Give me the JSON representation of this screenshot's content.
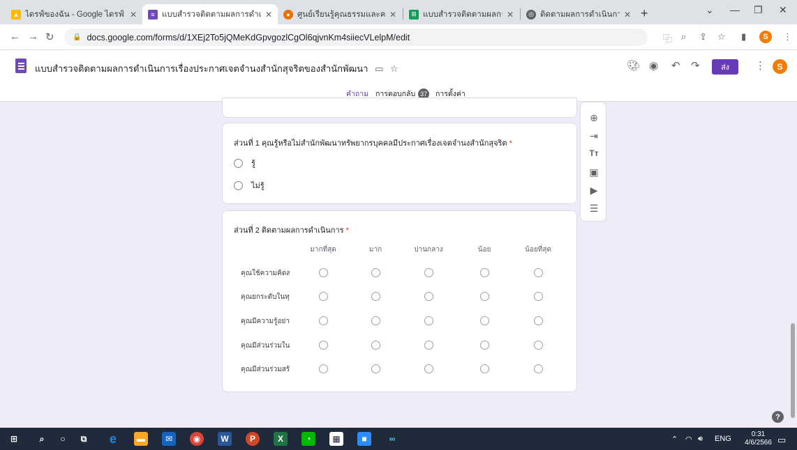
{
  "browser": {
    "tabs": [
      {
        "title": "ไดรฟ์ของฉัน - Google ไดรฟ์",
        "icon": "google-drive-icon",
        "color": "#1fa463"
      },
      {
        "title": "แบบสำรวจติดตามผลการดำเนินการ",
        "icon": "google-forms-icon",
        "color": "#7248b9"
      },
      {
        "title": "ศูนย์เรียนรู้คุณธรรมและความโปร่งใส",
        "icon": "site-icon",
        "color": "#e8710a"
      },
      {
        "title": "แบบสำรวจติดตามผลการดำเนินการ",
        "icon": "google-sheets-icon",
        "color": "#0f9d58"
      },
      {
        "title": "ติดตามผลการดำเนินการและรายงาน",
        "icon": "globe-icon",
        "color": "#5f6368"
      }
    ],
    "url": "docs.google.com/forms/d/1XEj2To5jQMeKdGpvgozlCgOl6qjvnKm4siiecVLelpM/edit",
    "profile_initial": "S"
  },
  "form_header": {
    "title": "แบบสำรวจติดตามผลการดำเนินการเรื่องประกาศเจตจำนงสำนักสุจริตของสำนักพัฒนา",
    "send_label": "ส่ง",
    "avatar_initial": "S",
    "tabs": {
      "questions": "คำถาม",
      "responses": "การตอบกลับ",
      "responses_count": "37",
      "settings": "การตั้งค่า"
    }
  },
  "section1": {
    "question": "ส่วนที่ 1 คุณรู้หรือไม่สำนักพัฒนาทรัพยากรบุคคลมีประกาศเรื่องเจตจำนงสำนักสุจริต",
    "required_mark": "*",
    "options": [
      "รู้",
      "ไม่รู้"
    ]
  },
  "section2": {
    "question": "ส่วนที่ 2 ติดตามผลการดำเนินการ",
    "required_mark": "*",
    "columns": [
      "มากที่สุด",
      "มาก",
      "ปานกลาง",
      "น้อย",
      "น้อยที่สุด"
    ],
    "rows": [
      "คุณใช้ความคิดส...",
      "คุณยกระดับในทุ...",
      "คุณมีความรู้อย่าง...",
      "คุณมีส่วนร่วมใน...",
      "คุณมีส่วนร่วมสร้า..."
    ]
  },
  "help_label": "?",
  "taskbar": {
    "lang": "ENG",
    "time": "0:31",
    "date": "4/6/2566"
  },
  "colors": {
    "accent": "#673ab7",
    "background": "#f0ebf8",
    "required": "#d93025"
  }
}
